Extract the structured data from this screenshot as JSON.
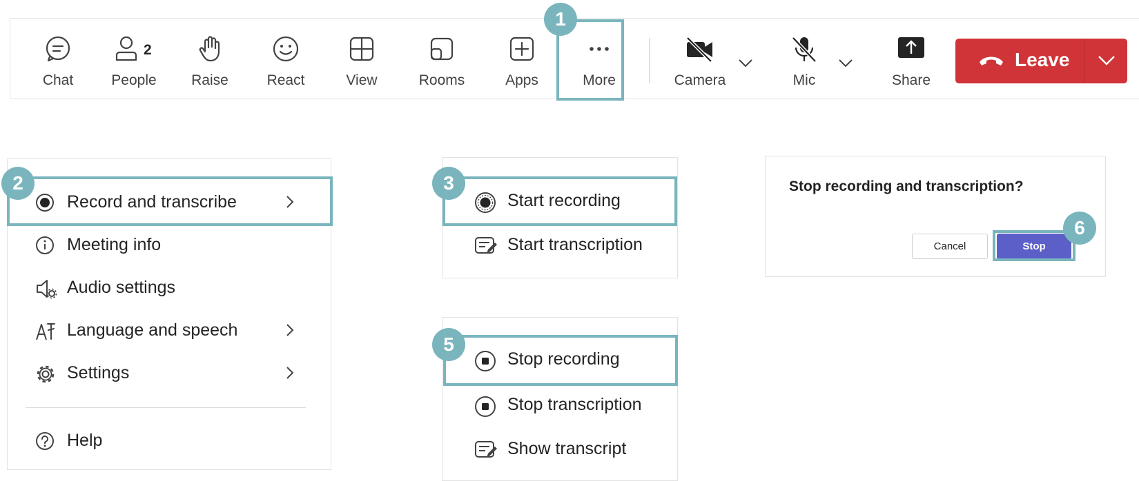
{
  "toolbar": {
    "chat": {
      "label": "Chat",
      "icon": "chat-icon"
    },
    "people": {
      "label": "People",
      "count": "2",
      "icon": "people-icon"
    },
    "raise": {
      "label": "Raise",
      "icon": "hand-icon"
    },
    "react": {
      "label": "React",
      "icon": "smiley-icon"
    },
    "view": {
      "label": "View",
      "icon": "grid-icon"
    },
    "rooms": {
      "label": "Rooms",
      "icon": "rooms-icon"
    },
    "apps": {
      "label": "Apps",
      "icon": "plus-square-icon"
    },
    "more": {
      "label": "More",
      "icon": "ellipsis-icon"
    },
    "camera": {
      "label": "Camera",
      "icon": "camera-off-icon"
    },
    "mic": {
      "label": "Mic",
      "icon": "mic-off-icon"
    },
    "share": {
      "label": "Share",
      "icon": "share-tray-icon"
    },
    "leave": {
      "label": "Leave",
      "icon": "phone-hangup-icon",
      "color": "#d13438"
    }
  },
  "steps": {
    "s1": "1",
    "s2": "2",
    "s3": "3",
    "s5": "5",
    "s6": "6"
  },
  "more_menu": {
    "items": [
      {
        "label": "Record and transcribe",
        "icon": "record-icon",
        "submenu": true
      },
      {
        "label": "Meeting info",
        "icon": "info-icon",
        "submenu": false
      },
      {
        "label": "Audio settings",
        "icon": "speaker-gear-icon",
        "submenu": false
      },
      {
        "label": "Language and speech",
        "icon": "language-icon",
        "submenu": true
      },
      {
        "label": "Settings",
        "icon": "gear-icon",
        "submenu": true
      }
    ],
    "help": {
      "label": "Help",
      "icon": "help-icon"
    }
  },
  "record_submenu": {
    "items": [
      {
        "label": "Start recording",
        "icon": "record-start-icon"
      },
      {
        "label": "Start transcription",
        "icon": "transcript-icon"
      }
    ]
  },
  "recording_submenu": {
    "items": [
      {
        "label": "Stop recording",
        "icon": "stop-circle-icon"
      },
      {
        "label": "Stop transcription",
        "icon": "stop-circle-icon"
      },
      {
        "label": "Show transcript",
        "icon": "transcript-icon"
      }
    ]
  },
  "dialog": {
    "title": "Stop recording and transcription?",
    "cancel": "Cancel",
    "stop": "Stop",
    "stop_color": "#5b5fc7"
  },
  "colors": {
    "highlight": "#7ab5bd",
    "leave": "#d13438",
    "stop": "#5b5fc7"
  }
}
